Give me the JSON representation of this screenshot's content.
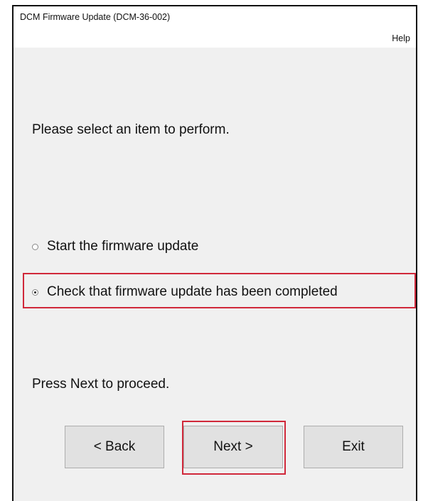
{
  "window": {
    "title": "DCM Firmware Update (DCM-36-002)",
    "help_label": "Help"
  },
  "content": {
    "prompt": "Please select an item to perform.",
    "options": [
      {
        "label": "Start the firmware update",
        "selected": false
      },
      {
        "label": "Check that firmware update has been completed",
        "selected": true
      }
    ],
    "hint": "Press Next to proceed."
  },
  "buttons": {
    "back": "< Back",
    "next": "Next >",
    "exit": "Exit"
  },
  "colors": {
    "highlight": "#d0283a",
    "dialog_bg": "#f0f0f0",
    "button_bg": "#e1e1e1"
  }
}
